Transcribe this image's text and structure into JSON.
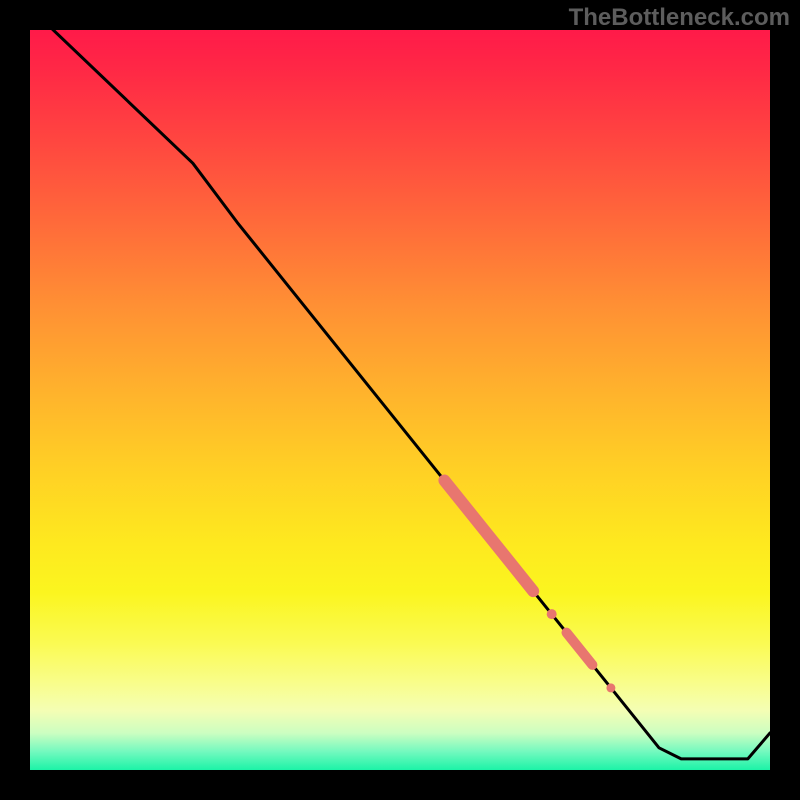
{
  "watermark": "TheBottleneck.com",
  "chart_data": {
    "type": "line",
    "title": "",
    "xlabel": "",
    "ylabel": "",
    "xlim": [
      0,
      100
    ],
    "ylim": [
      0,
      100
    ],
    "grid": false,
    "gradient_stops": [
      {
        "pos": 0,
        "color": "#ff1a49"
      },
      {
        "pos": 6,
        "color": "#ff2a45"
      },
      {
        "pos": 15,
        "color": "#ff4640"
      },
      {
        "pos": 26,
        "color": "#ff6a3a"
      },
      {
        "pos": 37,
        "color": "#ff8f34"
      },
      {
        "pos": 48,
        "color": "#ffb02d"
      },
      {
        "pos": 59,
        "color": "#ffcf25"
      },
      {
        "pos": 69,
        "color": "#fee81f"
      },
      {
        "pos": 76,
        "color": "#fbf51f"
      },
      {
        "pos": 83,
        "color": "#fafb54"
      },
      {
        "pos": 88,
        "color": "#f9fd88"
      },
      {
        "pos": 92,
        "color": "#f4feb4"
      },
      {
        "pos": 95,
        "color": "#ccfec1"
      },
      {
        "pos": 97.5,
        "color": "#74f9bf"
      },
      {
        "pos": 100,
        "color": "#1cf3a7"
      }
    ],
    "series": [
      {
        "name": "bottleneck-curve",
        "color": "#000000",
        "points": [
          {
            "x": 0,
            "y": 103
          },
          {
            "x": 22,
            "y": 82
          },
          {
            "x": 28,
            "y": 74
          },
          {
            "x": 85,
            "y": 3
          },
          {
            "x": 88,
            "y": 1.5
          },
          {
            "x": 97,
            "y": 1.5
          },
          {
            "x": 100,
            "y": 5
          }
        ]
      }
    ],
    "highlights": [
      {
        "name": "highlight-segment-1",
        "on_series": "bottleneck-curve",
        "color": "#e8766f",
        "width": 12,
        "x_from": 56,
        "x_to": 68
      },
      {
        "name": "highlight-dot-1",
        "on_series": "bottleneck-curve",
        "color": "#e8766f",
        "radius": 5,
        "x": 70.5
      },
      {
        "name": "highlight-segment-2",
        "on_series": "bottleneck-curve",
        "color": "#e8766f",
        "width": 10,
        "x_from": 72.5,
        "x_to": 76
      },
      {
        "name": "highlight-dot-2",
        "on_series": "bottleneck-curve",
        "color": "#e8766f",
        "radius": 4.5,
        "x": 78.5
      }
    ]
  }
}
